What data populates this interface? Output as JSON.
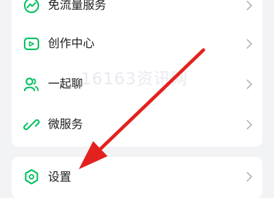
{
  "menu": {
    "items": [
      {
        "label": "免流量服务",
        "icon": "flow-chart-icon"
      },
      {
        "label": "创作中心",
        "icon": "video-camera-icon"
      },
      {
        "label": "一起聊",
        "icon": "users-icon"
      },
      {
        "label": "微服务",
        "icon": "link-icon"
      }
    ],
    "settings": {
      "label": "设置",
      "icon": "hexagon-settings-icon"
    }
  },
  "watermark": "16163资讯网",
  "colors": {
    "accent": "#07c160",
    "arrow": "#e3211e",
    "background": "#f2f3f5"
  }
}
